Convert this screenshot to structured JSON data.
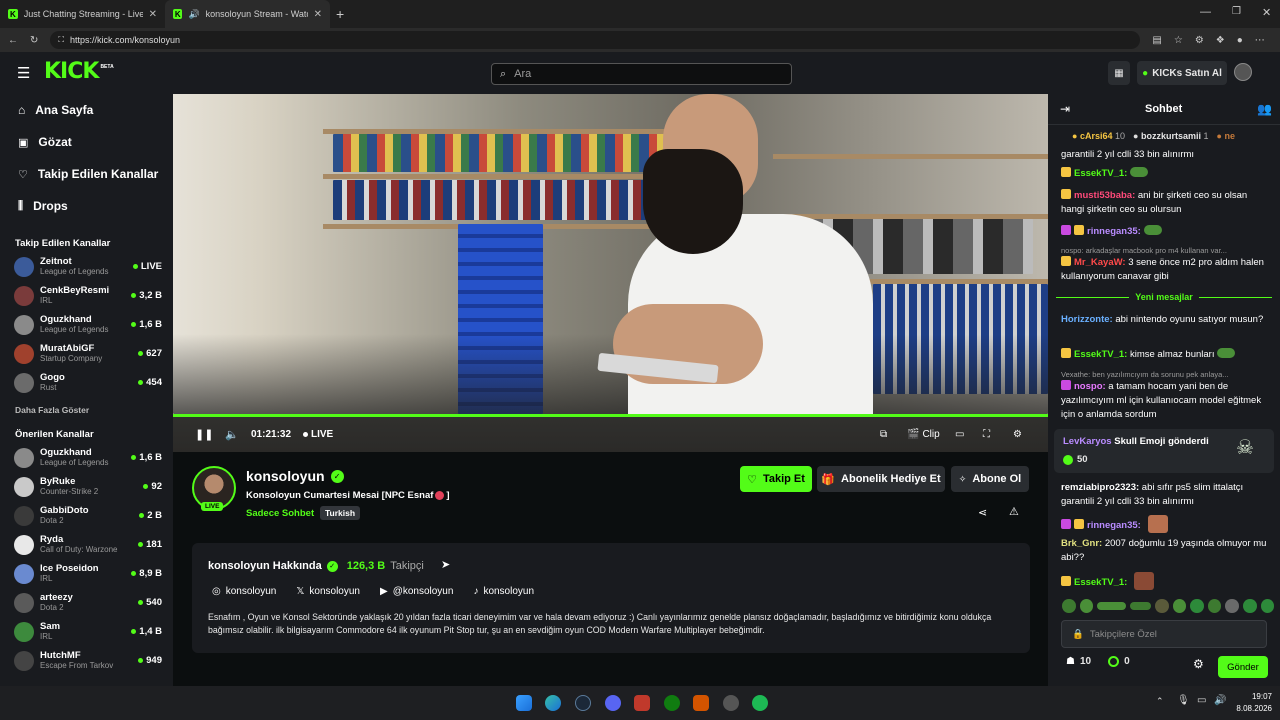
{
  "browser": {
    "tabs": [
      {
        "title": "Just Chatting Streaming - Live Stre"
      },
      {
        "title": "konsoloyun Stream - Watch L"
      }
    ],
    "url": "https://kick.com/konsoloyun"
  },
  "header": {
    "logo": "KICK",
    "logo_sup": "BETA",
    "search_placeholder": "Ara",
    "kicks_button": "KICKs Satın Al"
  },
  "sidebar": {
    "nav": [
      {
        "label": "Ana Sayfa",
        "icon": "home-icon"
      },
      {
        "label": "Gözat",
        "icon": "browse-icon"
      },
      {
        "label": "Takip Edilen Kanallar",
        "icon": "heart-icon"
      },
      {
        "label": "Drops",
        "icon": "drops-icon"
      }
    ],
    "followed_title": "Takip Edilen Kanallar",
    "followed": [
      {
        "name": "Zeitnot",
        "category": "League of Legends",
        "count": "LIVE",
        "color": "#3b5b9a"
      },
      {
        "name": "CenkBeyResmi",
        "category": "IRL",
        "count": "3,2 B",
        "color": "#7a3b3b"
      },
      {
        "name": "Oguzkhand",
        "category": "League of Legends",
        "count": "1,6 B",
        "color": "#8a8a8a"
      },
      {
        "name": "MuratAbiGF",
        "category": "Startup Company",
        "count": "627",
        "color": "#a0412d"
      },
      {
        "name": "Gogo",
        "category": "Rust",
        "count": "454",
        "color": "#6b6b6b"
      }
    ],
    "show_more": "Daha Fazla Göster",
    "recommended_title": "Önerilen Kanallar",
    "recommended": [
      {
        "name": "Oguzkhand",
        "category": "League of Legends",
        "count": "1,6 B",
        "color": "#8a8a8a"
      },
      {
        "name": "ByRuke",
        "category": "Counter-Strike 2",
        "count": "92",
        "color": "#c9c9c9"
      },
      {
        "name": "GabbiDoto",
        "category": "Dota 2",
        "count": "2 B",
        "color": "#3a3a3a"
      },
      {
        "name": "Ryda",
        "category": "Call of Duty: Warzone",
        "count": "181",
        "color": "#e8e8e8"
      },
      {
        "name": "Ice Poseidon",
        "category": "IRL",
        "count": "8,9 B",
        "color": "#6a8ad0"
      },
      {
        "name": "arteezy",
        "category": "Dota 2",
        "count": "540",
        "color": "#5a5a5a"
      },
      {
        "name": "Sam",
        "category": "IRL",
        "count": "1,4 B",
        "color": "#3d8a3d"
      },
      {
        "name": "HutchMF",
        "category": "Escape From Tarkov",
        "count": "949",
        "color": "#444"
      }
    ]
  },
  "player": {
    "time": "01:21:32",
    "live_label": "LIVE",
    "clip_label": "Clip",
    "progress": 1.0
  },
  "channel": {
    "name": "konsoloyun",
    "avatar_live": "LIVE",
    "title": "Konsoloyun Cumartesi Mesai [NPC Esnaf",
    "title_end": "]",
    "category": "Sadece Sohbet",
    "tag": "Turkish",
    "follow_label": "Takip Et",
    "gift_label": "Abonelik Hediye Et",
    "subscribe_label": "Abone Ol"
  },
  "about": {
    "title": "konsoloyun Hakkında",
    "followers": "126,3 B",
    "followers_label": "Takipçi",
    "socials": [
      {
        "label": "konsoloyun",
        "icon": "instagram-icon"
      },
      {
        "label": "konsoloyun",
        "icon": "x-icon"
      },
      {
        "label": "@konsoloyun",
        "icon": "youtube-icon"
      },
      {
        "label": "konsoloyun",
        "icon": "tiktok-icon"
      }
    ],
    "bio": "Esnafım , Oyun ve Konsol Sektoründe yaklaşık 20 yıldan fazla ticari deneyimim var ve hala devam ediyoruz :) Canlı yayınlarımız genelde plansız doğaçlamadır, başladığımız ve bitirdiğimiz konu oldukça bağımsız olabilir. ilk bilgisayarım Commodore 64 ilk oyunum Pit Stop tur, şu an en sevdiğim oyun COD Modern Warfare Multiplayer bebeğimdir."
  },
  "chat": {
    "title": "Sohbet",
    "leaders": [
      {
        "name": "cArsi64",
        "count": "10"
      },
      {
        "name": "bozzkurtsamii",
        "count": "1"
      },
      {
        "name": "ne",
        "count": ""
      }
    ],
    "m0_text": "garantili 2 yıl cdli 33 bin alınırmı",
    "m1_user": "EssekTV_1:",
    "m2_user": "musti53baba:",
    "m2_text": " ani bir şirketi ceo su olsan hangi şirketin ceo su olursun",
    "m3_user": "rinnegan35:",
    "r1": "nospo: arkadaşlar macbook pro m4 kullanan var...",
    "m4_user": "Mr_KayaW:",
    "m4_text": " 3 sene önce m2 pro aldım halen kullanıyorum canavar gibi",
    "new_messages": "Yeni mesajlar",
    "m5_user": "Horizzonte:",
    "m5_text": " abi nintendo oyunu satıyor musun?",
    "m6_user": "EssekTV_1:",
    "m6_text": " kimse almaz bunları",
    "r2": "Vexathe: ben yazılımcıyım da sorunu pek anlaya...",
    "m7_user": "nospo:",
    "m7_text": " a tamam hocam yani ben de yazılımcıyım ml için kullanıocam model eğitmek için o anlamda sordum",
    "gift_user": "LevKaryos",
    "gift_text": " Skull Emoji gönderdi",
    "gift_amount": "50",
    "m8_user": "remziabipro2323:",
    "m8_text": " abi sıfır ps5 slim ittalatçı garantili 2 yıl cdli 33 bin alınırmı",
    "m9_user": "rinnegan35:",
    "m10_user": "Brk_Gnr:",
    "m10_text": " 2007 doğumlu 19 yaşında olmuyor mu abi??",
    "m11_user": "EssekTV_1:",
    "input_placeholder": "Takipçilere Özel",
    "kicks_count": "10",
    "points": "0",
    "send_label": "Gönder"
  },
  "taskbar": {
    "time": "19:07",
    "date": "8.08.2026"
  }
}
